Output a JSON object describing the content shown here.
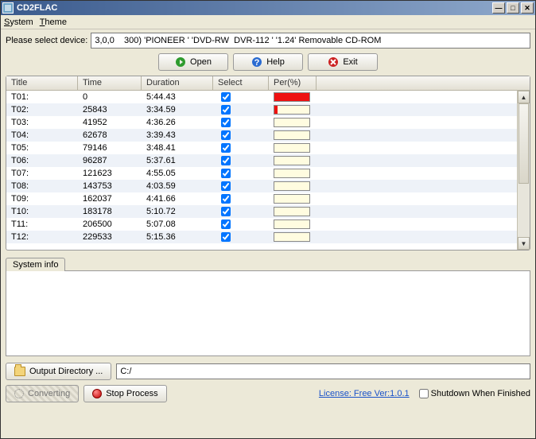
{
  "window": {
    "title": "CD2FLAC"
  },
  "menu": {
    "system": "System",
    "theme": "Theme"
  },
  "device": {
    "label": "Please select device:",
    "value": "3,0,0    300) 'PIONEER ' 'DVD-RW  DVR-112 ' '1.24' Removable CD-ROM"
  },
  "buttons": {
    "open": "Open",
    "help": "Help",
    "exit": "Exit"
  },
  "table": {
    "headers": {
      "title": "Title",
      "time": "Time",
      "duration": "Duration",
      "select": "Select",
      "per": "Per(%)"
    },
    "rows": [
      {
        "title": "T01:",
        "time": "0",
        "duration": "5:44.43",
        "selected": true,
        "percent": 100
      },
      {
        "title": "T02:",
        "time": "25843",
        "duration": "3:34.59",
        "selected": true,
        "percent": 8
      },
      {
        "title": "T03:",
        "time": "41952",
        "duration": "4:36.26",
        "selected": true,
        "percent": 0
      },
      {
        "title": "T04:",
        "time": "62678",
        "duration": "3:39.43",
        "selected": true,
        "percent": 0
      },
      {
        "title": "T05:",
        "time": "79146",
        "duration": "3:48.41",
        "selected": true,
        "percent": 0
      },
      {
        "title": "T06:",
        "time": "96287",
        "duration": "5:37.61",
        "selected": true,
        "percent": 0
      },
      {
        "title": "T07:",
        "time": "121623",
        "duration": "4:55.05",
        "selected": true,
        "percent": 0
      },
      {
        "title": "T08:",
        "time": "143753",
        "duration": "4:03.59",
        "selected": true,
        "percent": 0
      },
      {
        "title": "T09:",
        "time": "162037",
        "duration": "4:41.66",
        "selected": true,
        "percent": 0
      },
      {
        "title": "T10:",
        "time": "183178",
        "duration": "5:10.72",
        "selected": true,
        "percent": 0
      },
      {
        "title": "T11:",
        "time": "206500",
        "duration": "5:07.08",
        "selected": true,
        "percent": 0
      },
      {
        "title": "T12:",
        "time": "229533",
        "duration": "5:15.36",
        "selected": true,
        "percent": 0
      }
    ]
  },
  "sysinfo": {
    "tab": "System info"
  },
  "output": {
    "button": "Output Directory ...",
    "path": "C:/"
  },
  "bottom": {
    "converting": "Converting",
    "stop": "Stop Process",
    "license": "License: Free Ver:1.0.1",
    "shutdown_label": "Shutdown When Finished",
    "shutdown_checked": false
  }
}
